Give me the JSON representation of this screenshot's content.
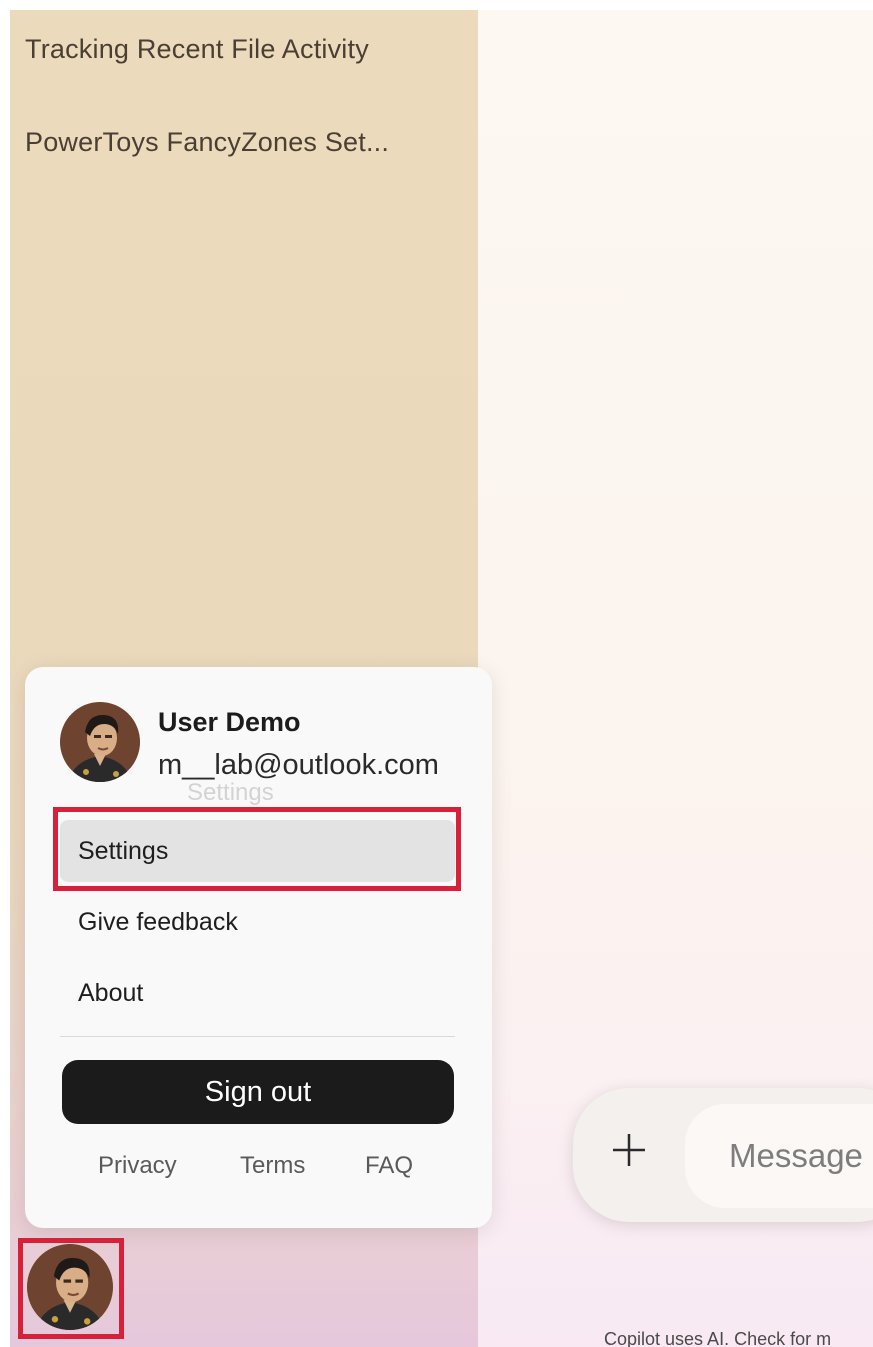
{
  "sidebar": {
    "conversations": [
      {
        "label": "Tracking Recent File Activity"
      },
      {
        "label": "PowerToys FancyZones Set..."
      }
    ]
  },
  "account_menu": {
    "user_name": "User Demo",
    "user_email": "m__lab@outlook.com",
    "tooltip_text": "Settings",
    "items": [
      {
        "label": "Settings",
        "active": true
      },
      {
        "label": "Give feedback"
      },
      {
        "label": "About"
      }
    ],
    "sign_out_label": "Sign out",
    "footer_links": [
      "Privacy",
      "Terms",
      "FAQ"
    ]
  },
  "composer": {
    "placeholder": "Message",
    "add_icon": "plus-icon"
  },
  "disclaimer": "Copilot uses AI. Check for m",
  "colors": {
    "highlight": "#d7213a",
    "sign_out_bg": "#1b1b1b",
    "sidebar_bg": "#ecdabd"
  },
  "icons": {
    "avatar": "user-avatar-photo",
    "add": "plus-icon"
  }
}
